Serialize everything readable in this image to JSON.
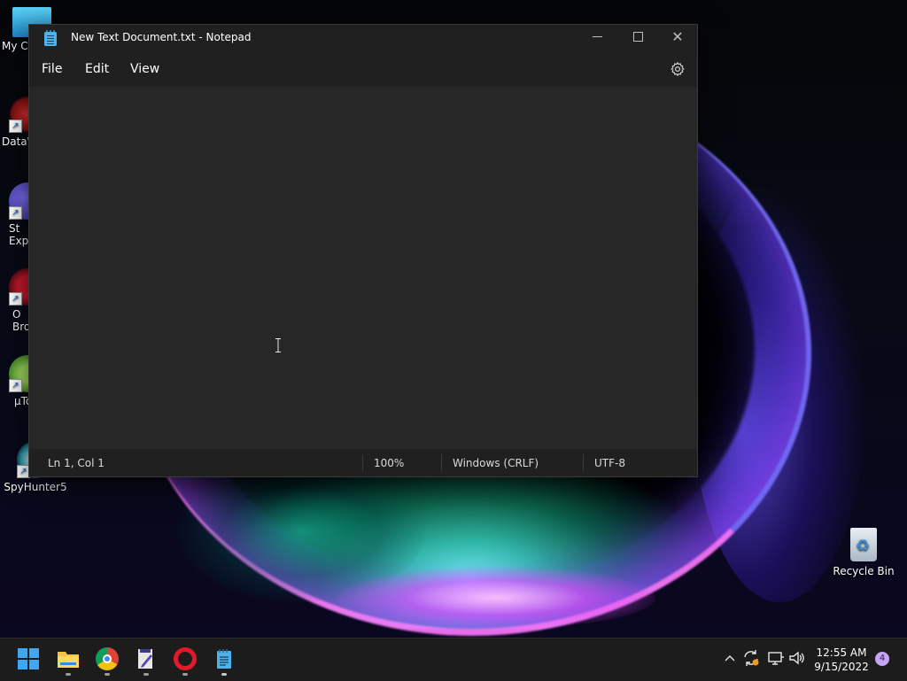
{
  "desktop": {
    "icons": [
      {
        "label": "My Co"
      },
      {
        "label": "DataW"
      },
      {
        "label": "St\nExp"
      },
      {
        "label": "O\nBro"
      },
      {
        "label": "µTo"
      },
      {
        "label": "SpyHunter5"
      }
    ],
    "recycle_bin": {
      "label": "Recycle Bin"
    }
  },
  "window": {
    "title": "New Text Document.txt - Notepad",
    "menu": {
      "file": "File",
      "edit": "Edit",
      "view": "View"
    },
    "editor_text": "",
    "status": {
      "position": "Ln 1, Col 1",
      "zoom": "100%",
      "line_endings": "Windows (CRLF)",
      "encoding": "UTF-8"
    }
  },
  "taskbar": {
    "clock": {
      "time": "12:55 AM",
      "date": "9/15/2022"
    },
    "notification_count": "4"
  },
  "colors": {
    "window_bg": "#202020",
    "editor_bg": "#272727",
    "accent": "#3fa7f2"
  }
}
